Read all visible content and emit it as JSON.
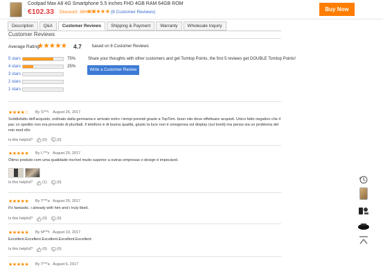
{
  "product": {
    "title": "Coolpad Max A8 4G Smartphone 5.5 inches FHD 4GB RAM 64GB ROM",
    "price": "€102.33",
    "discount": "Discount: 36% Off",
    "stars": "★★★★★",
    "reviews_link": "(8 Customer Reviews)",
    "buy_label": "Buy Now"
  },
  "tabs": [
    "Description",
    "Q&A",
    "Customer Reviews",
    "Shipping & Payment",
    "Warranty",
    "Wholesale Inquiry"
  ],
  "active_tab": "Customer Reviews",
  "section_title": "Customer Reviews",
  "summary": {
    "avg_label": "Average Rating:",
    "avg_stars": "★★★★★",
    "avg_value": "4.7",
    "based_on": "based on 8 Customer Reviews",
    "share_text": "Share your thoughts with other customers and get Tomtop Points, the first 5 reviews get DOUBLE Tomtop Points!",
    "write_label": "Write a Customer Review",
    "distribution": [
      {
        "label": "5 stars",
        "percent": 75,
        "percent_text": "75%"
      },
      {
        "label": "4 stars",
        "percent": 25,
        "percent_text": "25%"
      },
      {
        "label": "3 stars",
        "percent": 0,
        "percent_text": ""
      },
      {
        "label": "2 stars",
        "percent": 0,
        "percent_text": ""
      },
      {
        "label": "1 stars",
        "percent": 0,
        "percent_text": ""
      }
    ]
  },
  "helpful_label": "Is this helpful?",
  "reviews": [
    {
      "stars": "★★★★☆",
      "by": "By S***i",
      "date": "August 26, 2017",
      "text": "Soddisfatto dell'acquisto, ordinato dalla germania e arrivato entro i tempi previsti grazie a TopTom. buon sito dove effettuare acquisti. Unico fatto negativo che il pac co spedito non era provvisto di pluriball. Il telefono è di buona qualità, giusto la luce non è omogenea sul display (sul bordi) ma penso sia un problema del mio mod ello",
      "up": "(0)",
      "down": "(0)"
    },
    {
      "stars": "★★★★★",
      "by": "By L***s",
      "date": "August 25, 2017",
      "text": "Ótimo produto com uma qualidade incrível muito superior a outras empresas o design é impecável.",
      "up": "(1)",
      "down": "(0)"
    },
    {
      "stars": "★★★★★",
      "by": "By T***a",
      "date": "August 25, 2017",
      "text": "It's fantastic. i already with him and i truly liked.",
      "up": "(0)",
      "down": "(0)"
    },
    {
      "stars": "★★★★★",
      "by": "By M***t",
      "date": "August 10, 2017",
      "text": "Excellent.Excellent.Excellent.Excellent.Excellent.",
      "up": "(0)",
      "down": "(0)"
    },
    {
      "stars": "★★★★★",
      "by": "By T***a",
      "date": "August 6, 2017",
      "text": "",
      "up": "",
      "down": ""
    }
  ],
  "colors": {
    "accent": "#ff7d00",
    "star": "#ff8a00",
    "link": "#3366cc",
    "price": "#e4393c",
    "button": "#3c7bd5"
  },
  "side_icons": [
    "history-icon",
    "phone-thumb-icon",
    "accessory-thumb-icon",
    "gadget-thumb-icon",
    "back-to-top-icon"
  ]
}
